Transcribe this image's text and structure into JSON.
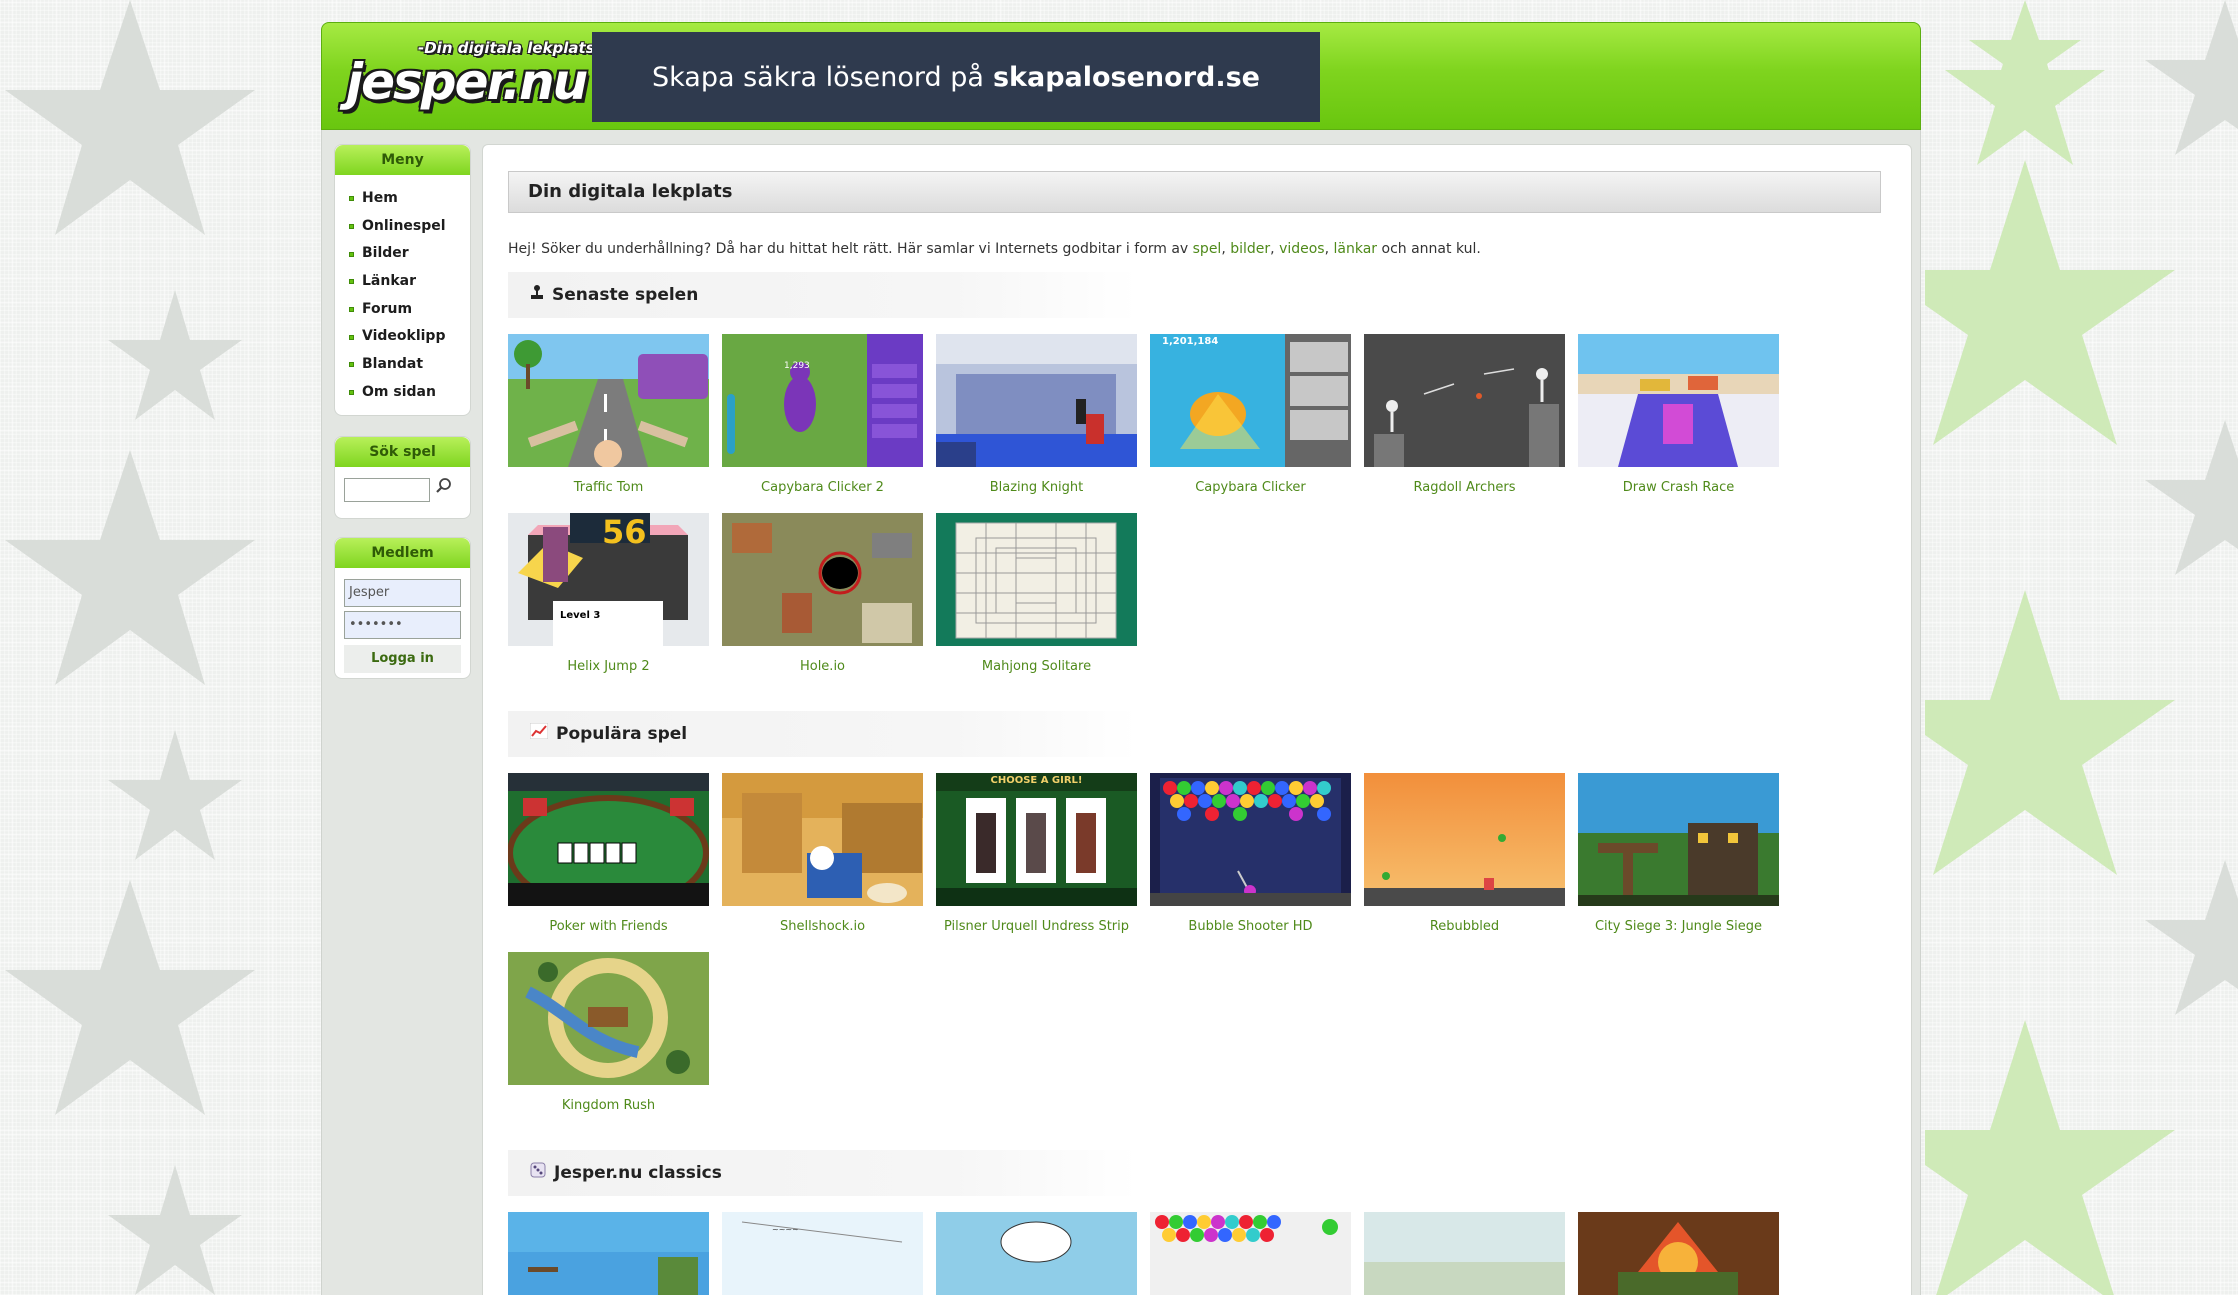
{
  "header": {
    "tagline": "-Din digitala lekplats!",
    "logo_text": "jesper.nu",
    "banner_prefix": "Skapa säkra lösenord på",
    "banner_domain": "skapalosenord.se"
  },
  "sidebar": {
    "menu_title": "Meny",
    "menu_items": [
      "Hem",
      "Onlinespel",
      "Bilder",
      "Länkar",
      "Forum",
      "Videoklipp",
      "Blandat",
      "Om sidan"
    ],
    "search_title": "Sök spel",
    "member_title": "Medlem",
    "username_value": "Jesper",
    "password_mask": "•••••••",
    "login_label": "Logga in"
  },
  "content": {
    "page_title": "Din digitala lekplats",
    "intro_before": "Hej! Söker du underhållning? Då har du hittat helt rätt. Här samlar vi Internets godbitar i form av ",
    "intro_links": [
      "spel",
      "bilder",
      "videos",
      "länkar"
    ],
    "intro_after": " och annat kul.",
    "sections": [
      {
        "title": "Senaste spelen",
        "icon": "joystick-icon",
        "games": [
          "Traffic Tom",
          "Capybara Clicker 2",
          "Blazing Knight",
          "Capybara Clicker",
          "Ragdoll Archers",
          "Draw Crash Race",
          "Helix Jump 2",
          "Hole.io",
          "Mahjong Solitare"
        ]
      },
      {
        "title": "Populära spel",
        "icon": "chart-icon",
        "games": [
          "Poker with Friends",
          "Shellshock.io",
          "Pilsner Urquell Undress Strip",
          "Bubble Shooter HD",
          "Rebubbled",
          "City Siege 3: Jungle Siege",
          "Kingdom Rush"
        ]
      },
      {
        "title": "Jesper.nu classics",
        "icon": "dice-icon",
        "games": [
          "",
          "",
          "",
          "",
          "",
          ""
        ]
      }
    ],
    "thumb_texts": {
      "helix_level": "Level 3",
      "helix_score": "56",
      "pilsner_header": "CHOOSE A GIRL!",
      "capybara_score": "1,201,184"
    }
  },
  "colors": {
    "header_green": "#7fd41e",
    "link_green": "#4f8a1a",
    "banner_bg": "#2f3a4e"
  }
}
